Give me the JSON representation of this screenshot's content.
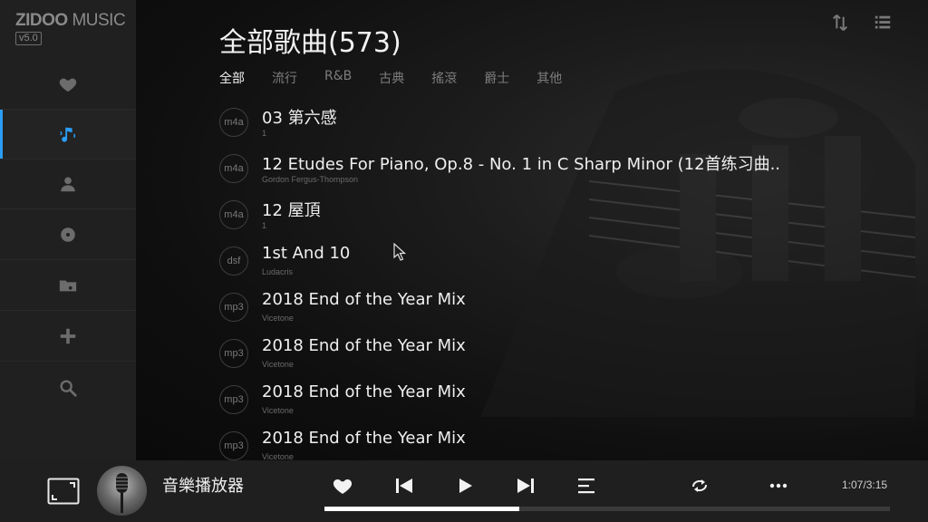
{
  "app": {
    "logo_brand": "ZIDOO",
    "logo_sub": " MUSIC",
    "version": "v5.0"
  },
  "sidebar": {
    "items": [
      {
        "name": "favorites",
        "icon": "heart-icon",
        "active": false
      },
      {
        "name": "songs",
        "icon": "music-note-icon",
        "active": true
      },
      {
        "name": "artists",
        "icon": "person-icon",
        "active": false
      },
      {
        "name": "albums",
        "icon": "disc-icon",
        "active": false
      },
      {
        "name": "folders",
        "icon": "folder-icon",
        "active": false
      },
      {
        "name": "add",
        "icon": "plus-icon",
        "active": false
      },
      {
        "name": "search",
        "icon": "search-icon",
        "active": false
      }
    ]
  },
  "header": {
    "title": "全部歌曲(573)",
    "sort_icon": "sort-icon",
    "list_icon": "list-icon"
  },
  "tabs": [
    {
      "label": "全部",
      "active": true
    },
    {
      "label": "流行",
      "active": false
    },
    {
      "label": "R&B",
      "active": false
    },
    {
      "label": "古典",
      "active": false
    },
    {
      "label": "搖滾",
      "active": false
    },
    {
      "label": "爵士",
      "active": false
    },
    {
      "label": "其他",
      "active": false
    }
  ],
  "songs": [
    {
      "format": "m4a",
      "title": "03 第六感",
      "artist": "1"
    },
    {
      "format": "m4a",
      "title": "12 Etudes For Piano, Op.8 - No. 1 in C Sharp Minor (12首练习曲..",
      "artist": "Gordon Fergus-Thompson"
    },
    {
      "format": "m4a",
      "title": "12 屋頂",
      "artist": "1"
    },
    {
      "format": "dsf",
      "title": "1st And 10",
      "artist": "Ludacris"
    },
    {
      "format": "mp3",
      "title": "2018 End of the Year Mix",
      "artist": "Vicetone"
    },
    {
      "format": "mp3",
      "title": "2018 End of the Year Mix",
      "artist": "Vicetone"
    },
    {
      "format": "mp3",
      "title": "2018 End of the Year Mix",
      "artist": "Vicetone"
    },
    {
      "format": "mp3",
      "title": "2018 End of the Year Mix",
      "artist": "Vicetone"
    }
  ],
  "player": {
    "now_playing_title": "音樂播放器",
    "time": "1:07/3:15",
    "progress": 0.344,
    "accent_color": "#2a9df4"
  }
}
